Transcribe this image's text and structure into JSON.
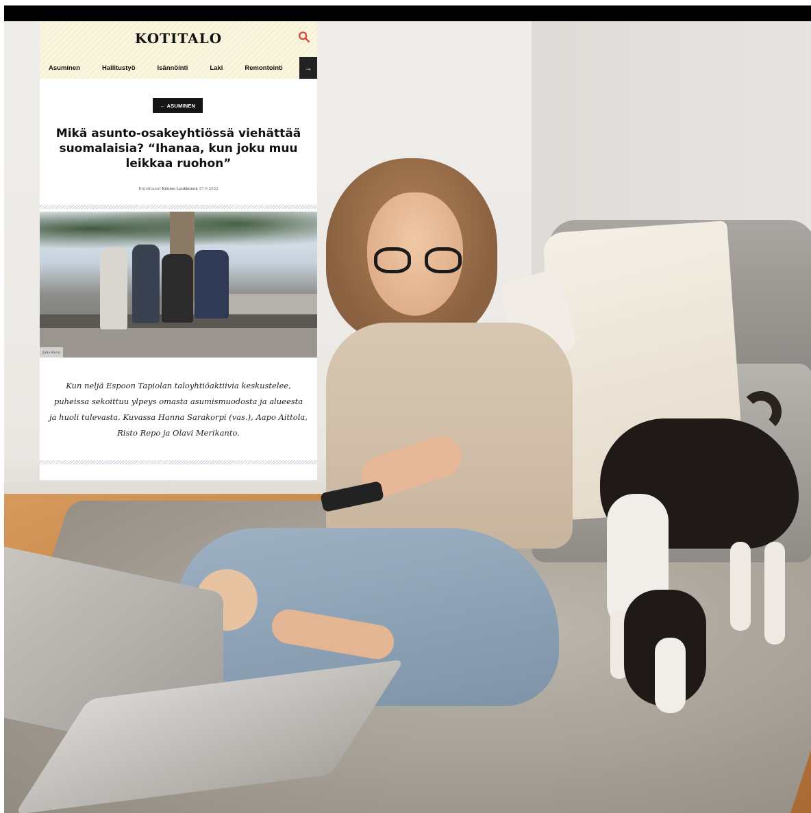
{
  "site": {
    "logo": "KOTITALO",
    "nav": [
      "Asuminen",
      "Hallitustyö",
      "Isännöinti",
      "Laki",
      "Remontointi"
    ],
    "nav_arrow": "→"
  },
  "article": {
    "category": "← ASUMINEN",
    "headline": "Mikä asunto-osakeyhtiössä viehättää suomalaisia? “Ihanaa, kun joku muu leikkaa ruohon”",
    "byline_prefix": "Kirjoittanut",
    "author": "Kimmo Luukkonen",
    "date": "27.9.2022",
    "photo_credit": "Juho Kuva",
    "caption": "Kun neljä Espoon Tapiolan taloyhtiöaktiivia keskustelee, puheissa sekoittuu ylpeys omasta asumismuodosta ja alueesta ja huoli tulevasta. Kuvassa Hanna Sarakorpi (vas.), Aapo Aittola, Risto Repo ja Olavi Merikanto."
  },
  "colors": {
    "header_bg": "#faf5de",
    "search_icon": "#e0453a",
    "category_bg": "#161616"
  }
}
